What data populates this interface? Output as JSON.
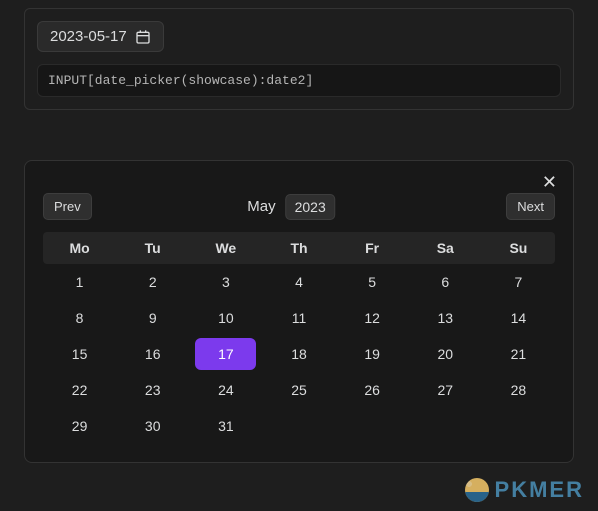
{
  "date_field": {
    "value": "2023-05-17"
  },
  "code_text": "INPUT[date_picker(showcase):date2]",
  "calendar": {
    "prev_label": "Prev",
    "next_label": "Next",
    "month": "May",
    "year": "2023",
    "weekdays": [
      "Mo",
      "Tu",
      "We",
      "Th",
      "Fr",
      "Sa",
      "Su"
    ],
    "days": [
      1,
      2,
      3,
      4,
      5,
      6,
      7,
      8,
      9,
      10,
      11,
      12,
      13,
      14,
      15,
      16,
      17,
      18,
      19,
      20,
      21,
      22,
      23,
      24,
      25,
      26,
      27,
      28,
      29,
      30,
      31
    ],
    "selected_day": 17
  },
  "watermark": "PKMER"
}
